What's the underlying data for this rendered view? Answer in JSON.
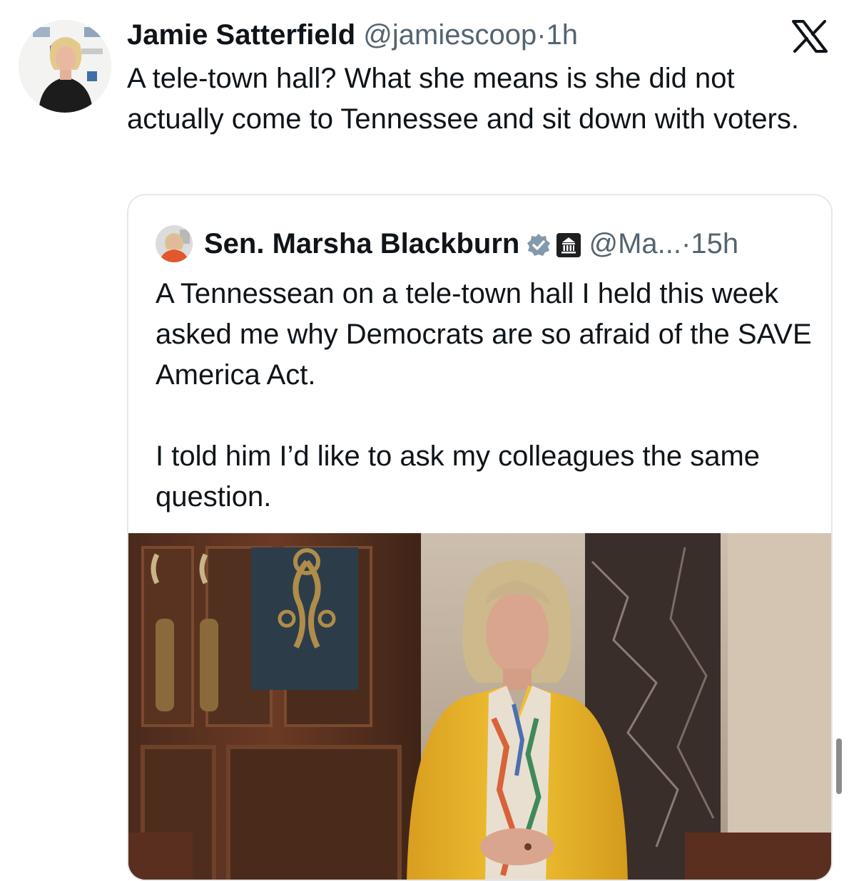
{
  "tweet": {
    "author_name": "Jamie Satterfield",
    "author_handle": "@jamiescoop",
    "separator": "·",
    "time": "1h",
    "text": "A tele-town hall? What she means is she did not actually come to Tennessee and sit down with voters.",
    "avatar_icon": "profile-photo-woman",
    "brand_icon": "x-logo-icon"
  },
  "quoted_tweet": {
    "author_name": "Sen. Marsha Blackburn",
    "author_handle": "@Ma...",
    "separator": "·",
    "time": "15h",
    "verified_icon": "verified-badge-icon",
    "affiliation_icon": "government-building-icon",
    "paragraphs": [
      "A Tennessean on a tele-town hall I held this week asked me why Democrats are so afraid of the SAVE America Act.",
      "I told him I’d like to ask my colleagues the same question."
    ],
    "media": {
      "kind": "video-still",
      "description_icon": "senate-floor-video-thumbnail"
    }
  },
  "colors": {
    "text": "#0f1419",
    "secondary": "#536471",
    "border": "#e4e8eb",
    "verified": "#829aab",
    "jacket": "#e8b625"
  }
}
